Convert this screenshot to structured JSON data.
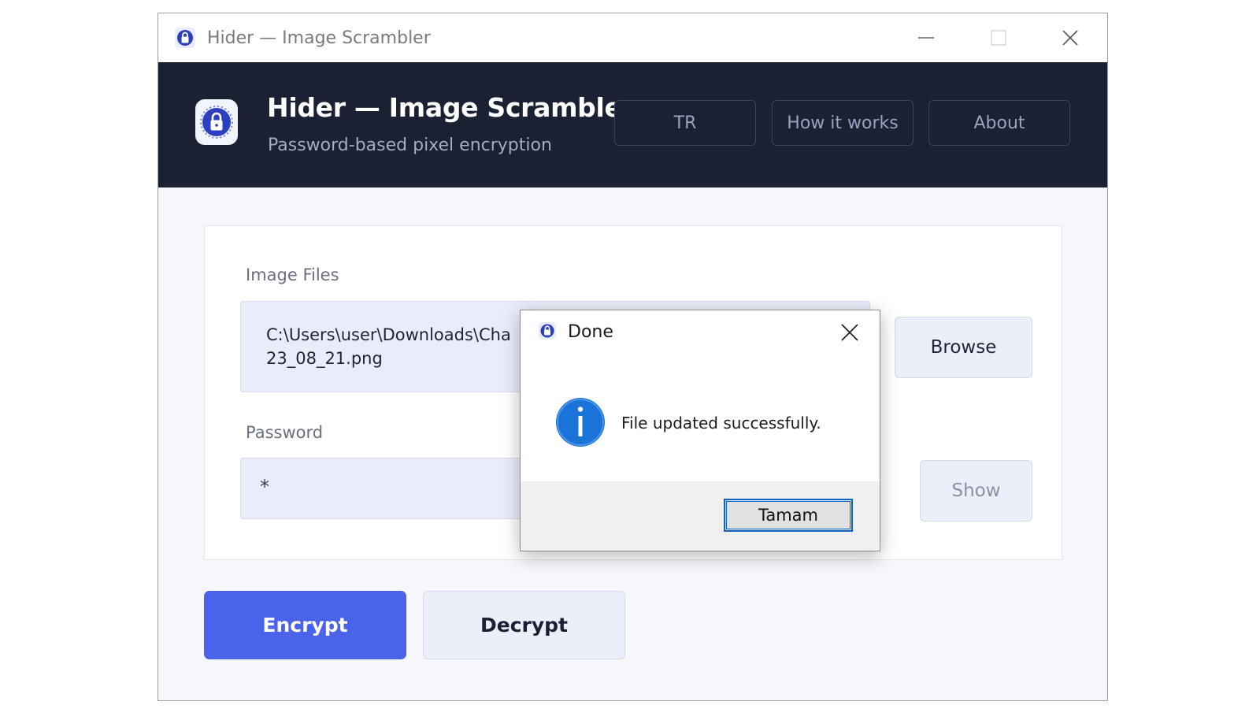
{
  "window": {
    "title": "Hider — Image Scrambler",
    "controls": {
      "minimize": "minimize-icon",
      "maximize": "maximize-icon",
      "close": "close-icon"
    }
  },
  "header": {
    "title": "Hider — Image Scrambler",
    "subtitle": "Password-based pixel encryption",
    "buttons": {
      "language": "TR",
      "how_it_works": "How it works",
      "about": "About"
    }
  },
  "form": {
    "files_label": "Image Files",
    "files_value": "C:\\Users\\user\\Downloads\\Cha... 23_08_21.png",
    "files_value_line1": "C:\\Users\\user\\Downloads\\Cha",
    "files_value_line2": "23_08_21.png",
    "browse_label": "Browse",
    "password_label": "Password",
    "password_value": "*",
    "show_label": "Show"
  },
  "actions": {
    "encrypt_label": "Encrypt",
    "decrypt_label": "Decrypt"
  },
  "dialog": {
    "title": "Done",
    "message": "File updated successfully.",
    "ok_label": "Tamam",
    "icon": "info-icon"
  },
  "colors": {
    "header_bg": "#1c2033",
    "accent": "#4a63ea",
    "field_bg": "#e9edf9",
    "info_blue": "#1a73d9"
  }
}
